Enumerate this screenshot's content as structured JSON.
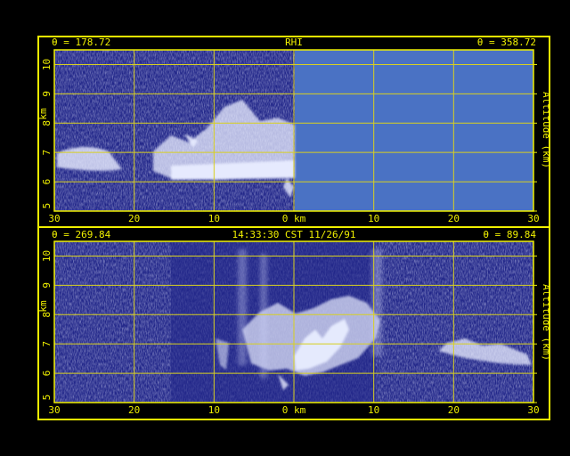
{
  "colors": {
    "background": "#000000",
    "frame": "#f0f000",
    "panel": "#23288a",
    "no_data": "#4a72c4",
    "echo": "#e8ecff",
    "grid": "#d8d020"
  },
  "top_panel": {
    "angle_left": "θ = 178.72",
    "title": "RHI",
    "angle_right": "θ = 358.72",
    "y_ticks": [
      "5",
      "6",
      "7",
      "8",
      "9",
      "10"
    ],
    "y_label_left": "km",
    "y_label_right": "Altitude (km)",
    "x_ticks": [
      "30",
      "20",
      "10",
      "0 km",
      "10",
      "20",
      "30"
    ]
  },
  "bottom_panel": {
    "angle_left": "θ = 269.84",
    "timestamp": "14:33:30 CST 11/26/91",
    "angle_right": "θ = 89.84",
    "y_ticks": [
      "5",
      "6",
      "7",
      "8",
      "9",
      "10"
    ],
    "y_label_left": "km",
    "y_label_right": "Altitude (km)",
    "x_ticks": [
      "30",
      "20",
      "10",
      "0 km",
      "10",
      "20",
      "30"
    ]
  }
}
